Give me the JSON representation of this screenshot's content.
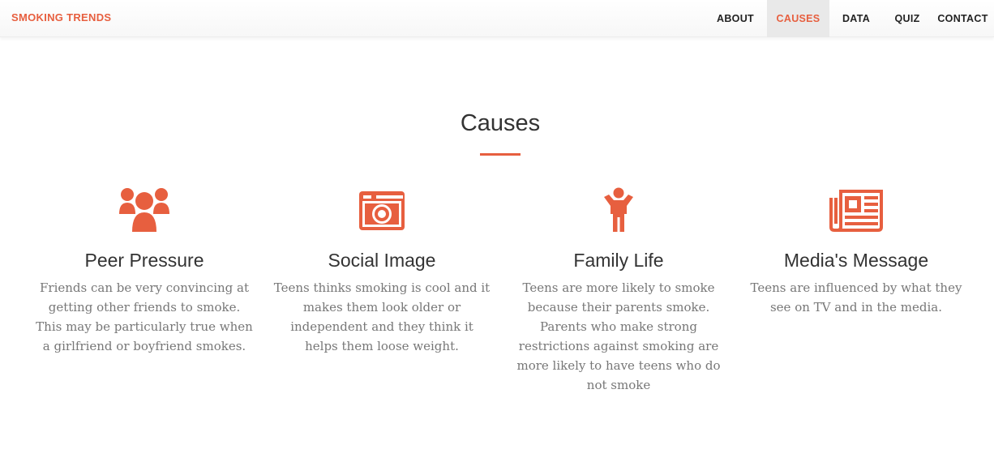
{
  "brand": "SMOKING TRENDS",
  "nav": {
    "about": "ABOUT",
    "causes": "CAUSES",
    "data": "DATA",
    "quiz": "QUIZ",
    "contact": "CONTACT",
    "active": "CAUSES"
  },
  "section": {
    "title": "Causes"
  },
  "causes": [
    {
      "icon": "users-icon",
      "title": "Peer Pressure",
      "text": "Friends can be very convincing at getting other friends to smoke. This may be particularly true when a girlfriend or boyfriend smokes."
    },
    {
      "icon": "camera-icon",
      "title": "Social Image",
      "text": "Teens thinks smoking is cool and it makes them look older or independent and they think it helps them loose weight."
    },
    {
      "icon": "child-icon",
      "title": "Family Life",
      "text": "Teens are more likely to smoke because their parents smoke. Parents who make strong restrictions against smoking are more likely to have teens who do not smoke"
    },
    {
      "icon": "newspaper-icon",
      "title": "Media's Message",
      "text": "Teens are influenced by what they see on TV and in the media."
    }
  ],
  "colors": {
    "accent": "#e75f3f",
    "text": "#333333",
    "muted": "#777777"
  }
}
